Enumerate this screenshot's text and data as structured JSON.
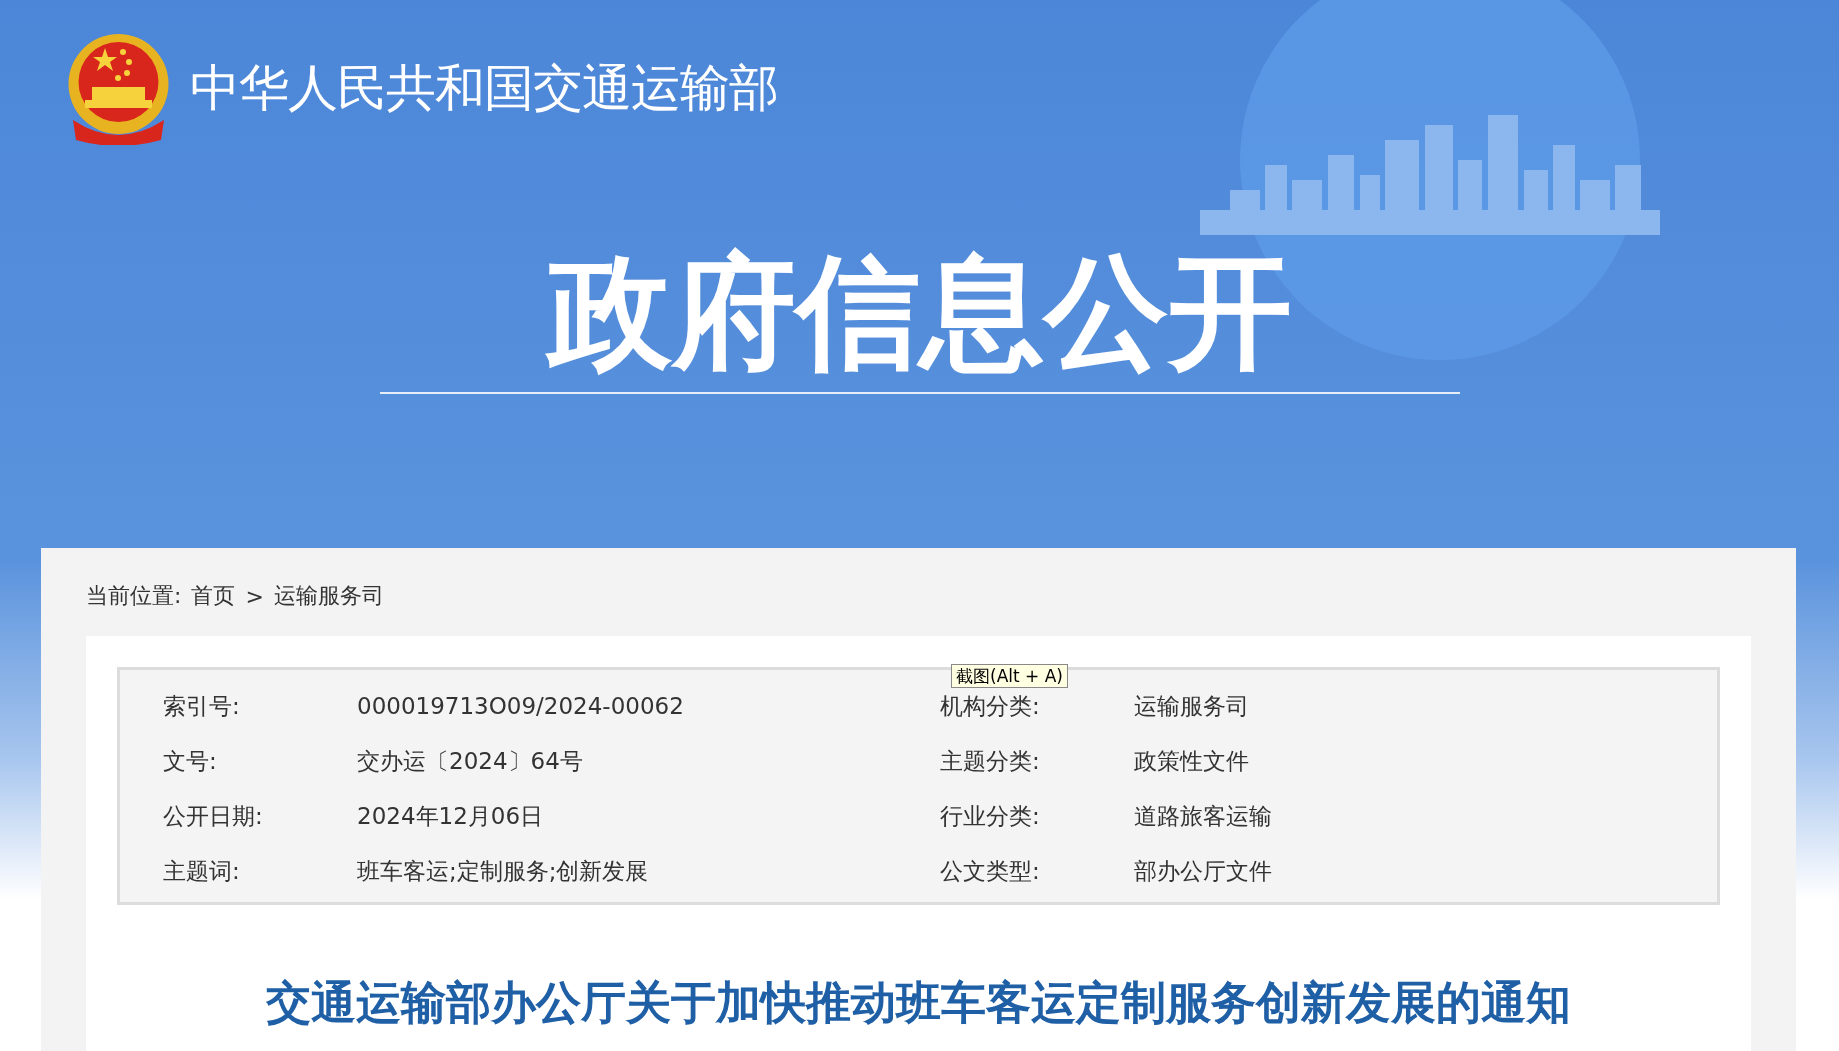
{
  "site": {
    "title": "中华人民共和国交通运输部"
  },
  "banner": {
    "title": "政府信息公开"
  },
  "breadcrumb": {
    "label": "当前位置:",
    "separator": ">",
    "items": [
      "首页",
      "运输服务司"
    ]
  },
  "meta": [
    {
      "label": "索引号:",
      "value": "000019713O09/2024-00062",
      "label_2": "机构分类:",
      "value_2": "运输服务司"
    },
    {
      "label": "文号:",
      "value": "交办运〔2024〕64号",
      "label_2": "主题分类:",
      "value_2": "政策性文件"
    },
    {
      "label": "公开日期:",
      "value": "2024年12月06日",
      "label_2": "行业分类:",
      "value_2": "道路旅客运输"
    },
    {
      "label": "主题词:",
      "value": "班车客运;定制服务;创新发展",
      "label_2": "公文类型:",
      "value_2": "部办公厅文件"
    }
  ],
  "tooltip": {
    "text": "截图(Alt + A)"
  },
  "document": {
    "title": "交通运输部办公厅关于加快推动班车客运定制服务创新发展的通知"
  }
}
